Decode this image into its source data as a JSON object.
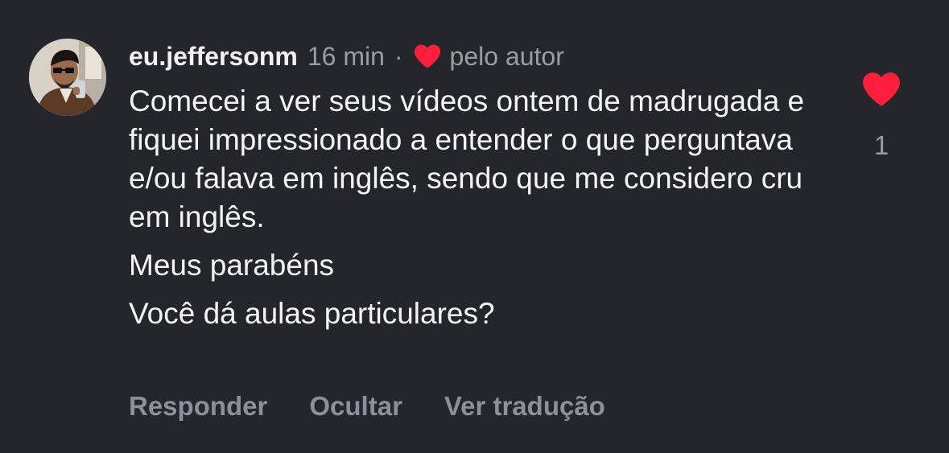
{
  "comment": {
    "username": "eu.jeffersonm",
    "time": "16 min",
    "separator": "·",
    "liked_by_author_label": "pelo autor",
    "paragraphs": [
      "Comecei a ver seus vídeos ontem de madrugada e fiquei impressionado a entender o que perguntava e/ou falava em inglês, sendo que me considero cru em inglês.",
      "Meus parabéns",
      "Você dá aulas particulares?"
    ],
    "like_count": "1",
    "liked": true
  },
  "actions": {
    "reply": "Responder",
    "hide": "Ocultar",
    "translate": "Ver tradução"
  },
  "icons": {
    "avatar": "profile-photo",
    "author_heart": "heart-icon",
    "like_heart": "heart-icon"
  },
  "colors": {
    "background": "#25262b",
    "heart": "#ff1f3d",
    "primary_text": "#f4f4f6",
    "secondary_text": "#9a9ca6",
    "action_text": "#8d8f99"
  }
}
